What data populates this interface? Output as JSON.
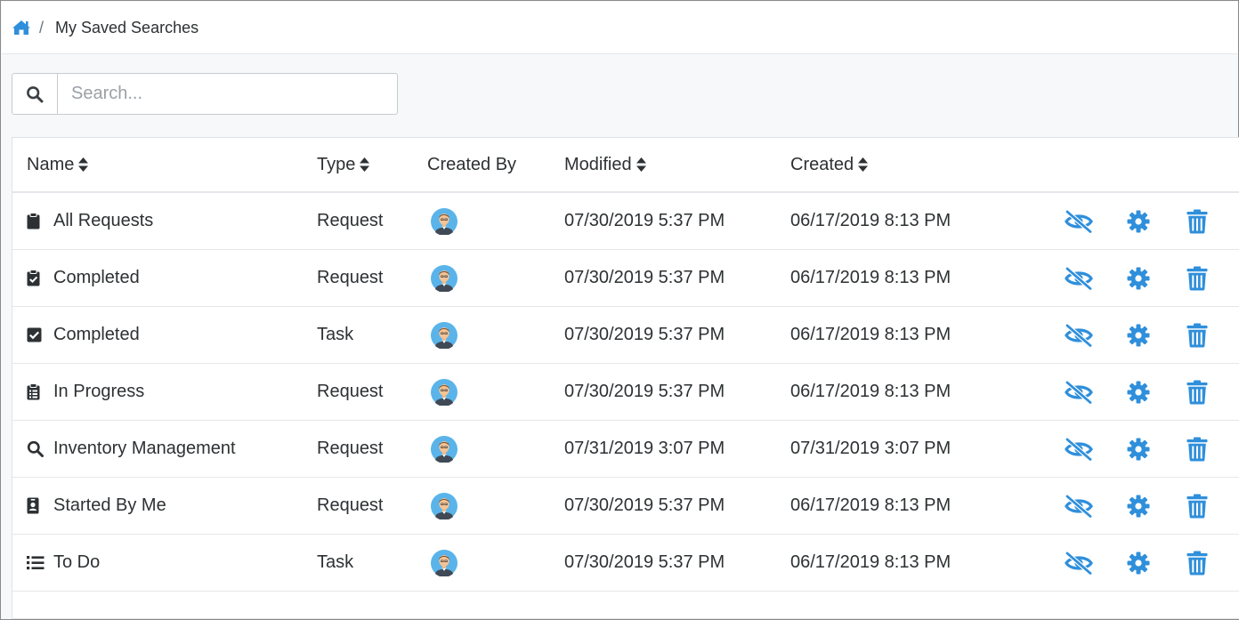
{
  "breadcrumb": {
    "home_icon": "home-icon",
    "separator": "/",
    "current": "My Saved Searches"
  },
  "search": {
    "placeholder": "Search...",
    "value": ""
  },
  "colors": {
    "accent": "#2f8fdb",
    "text": "#2d3133"
  },
  "table": {
    "columns": [
      {
        "label": "Name",
        "sortable": true
      },
      {
        "label": "Type",
        "sortable": true
      },
      {
        "label": "Created By",
        "sortable": false
      },
      {
        "label": "Modified",
        "sortable": true
      },
      {
        "label": "Created",
        "sortable": true
      }
    ],
    "rows": [
      {
        "icon": "clipboard-icon",
        "name": "All Requests",
        "type": "Request",
        "modified": "07/30/2019 5:37 PM",
        "created": "06/17/2019 8:13 PM"
      },
      {
        "icon": "clipboard-check-icon",
        "name": "Completed",
        "type": "Request",
        "modified": "07/30/2019 5:37 PM",
        "created": "06/17/2019 8:13 PM"
      },
      {
        "icon": "check-square-icon",
        "name": "Completed",
        "type": "Task",
        "modified": "07/30/2019 5:37 PM",
        "created": "06/17/2019 8:13 PM"
      },
      {
        "icon": "clipboard-list-icon",
        "name": "In Progress",
        "type": "Request",
        "modified": "07/30/2019 5:37 PM",
        "created": "06/17/2019 8:13 PM"
      },
      {
        "icon": "search-icon",
        "name": "Inventory Management",
        "type": "Request",
        "modified": "07/31/2019 3:07 PM",
        "created": "07/31/2019 3:07 PM"
      },
      {
        "icon": "id-badge-icon",
        "name": "Started By Me",
        "type": "Request",
        "modified": "07/30/2019 5:37 PM",
        "created": "06/17/2019 8:13 PM"
      },
      {
        "icon": "list-icon",
        "name": "To Do",
        "type": "Task",
        "modified": "07/30/2019 5:37 PM",
        "created": "06/17/2019 8:13 PM"
      }
    ],
    "row_actions": [
      "eye-slash-icon",
      "gear-icon",
      "trash-icon"
    ]
  }
}
